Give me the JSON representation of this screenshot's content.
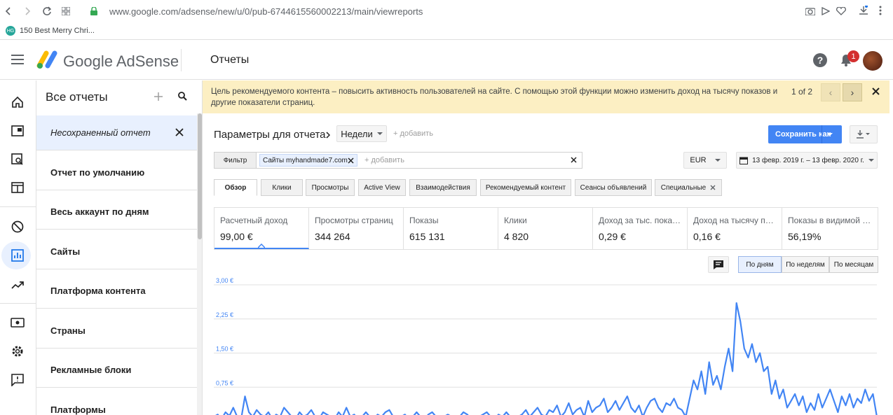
{
  "browser": {
    "url": "www.google.com/adsense/new/u/0/pub-6744615560002213/main/viewreports",
    "bookmark": "150 Best Merry Chri..."
  },
  "header": {
    "brand": "Google AdSense",
    "title": "Отчеты",
    "notifications": "1"
  },
  "sidebar": {
    "title": "Все отчеты",
    "items": [
      {
        "label": "Несохраненный отчет"
      },
      {
        "label": "Отчет по умолчанию"
      },
      {
        "label": "Весь аккаунт по дням"
      },
      {
        "label": "Сайты"
      },
      {
        "label": "Платформа контента"
      },
      {
        "label": "Страны"
      },
      {
        "label": "Рекламные блоки"
      },
      {
        "label": "Платформы"
      }
    ]
  },
  "notice": {
    "text": "Цель рекомендуемого контента – повысить активность пользователей на сайте. С помощью этой функции можно изменить доход на тысячу показов и другие показатели страниц.",
    "pages": "1 of 2"
  },
  "params": {
    "label": "Параметры для отчета:",
    "dimension": "Недели",
    "add": "+ добавить",
    "save": "Сохранить как"
  },
  "filter": {
    "label": "Фильтр",
    "chip": "Сайты myhandmade7.com",
    "add": "+ добавить",
    "currency": "EUR",
    "date_range": "13 февр. 2019 г. – 13 февр. 2020 г."
  },
  "tabs": [
    "Обзор",
    "Клики",
    "Просмотры",
    "Active View",
    "Взаимодействия",
    "Рекомендуемый контент",
    "Сеансы объявлений",
    "Специальные"
  ],
  "metrics": [
    {
      "label": "Расчетный доход",
      "value": "99,00 €"
    },
    {
      "label": "Просмотры страниц",
      "value": "344 264"
    },
    {
      "label": "Показы",
      "value": "615 131"
    },
    {
      "label": "Клики",
      "value": "4 820"
    },
    {
      "label": "Доход за тыс. показов",
      "value": "0,29 €"
    },
    {
      "label": "Доход на тысячу показов",
      "value": "0,16 €"
    },
    {
      "label": "Показы в видимой части",
      "value": "56,19%"
    }
  ],
  "granularity": [
    "По дням",
    "По неделям",
    "По месяцам"
  ],
  "chart_data": {
    "type": "line",
    "y_ticks": [
      "3,00 €",
      "2,25 €",
      "1,50 €",
      "0,75 €"
    ],
    "ylim": [
      0,
      3.0
    ],
    "series": [
      {
        "values": [
          0.1,
          0.15,
          0.05,
          0.2,
          0.12,
          0.3,
          0.1,
          0.05,
          0.55,
          0.2,
          0.1,
          0.25,
          0.15,
          0.1,
          0.2,
          0.05,
          0.15,
          0.1,
          0.3,
          0.2,
          0.1,
          0.05,
          0.2,
          0.1,
          0.15,
          0.25,
          0.1,
          0.05,
          0.2,
          0.15,
          0.1,
          0.05,
          0.2,
          0.1,
          0.3,
          0.1,
          0.15,
          0.05,
          0.1,
          0.2,
          0.1,
          0.05,
          0.15,
          0.1,
          0.2,
          0.25,
          0.1,
          0.05,
          0.1,
          0.15,
          0.05,
          0.1,
          0.2,
          0.1,
          0.05,
          0.15,
          0.2,
          0.1,
          0.05,
          0.1,
          0.15,
          0.1,
          0.05,
          0.1,
          0.2,
          0.15,
          0.05,
          0.1,
          0.1,
          0.15,
          0.2,
          0.1,
          0.05,
          0.15,
          0.1,
          0.2,
          0.1,
          0.05,
          0.1,
          0.15,
          0.25,
          0.1,
          0.2,
          0.3,
          0.15,
          0.1,
          0.25,
          0.2,
          0.35,
          0.1,
          0.2,
          0.4,
          0.15,
          0.25,
          0.3,
          0.1,
          0.45,
          0.2,
          0.3,
          0.35,
          0.5,
          0.2,
          0.3,
          0.45,
          0.25,
          0.4,
          0.55,
          0.3,
          0.2,
          0.35,
          0.1,
          0.3,
          0.45,
          0.5,
          0.3,
          0.2,
          0.4,
          0.35,
          0.5,
          0.3,
          0.25,
          0.1,
          0.5,
          0.9,
          0.7,
          1.1,
          0.6,
          1.3,
          0.8,
          1.0,
          0.7,
          1.2,
          1.6,
          1.1,
          2.6,
          2.2,
          1.6,
          1.4,
          1.7,
          1.3,
          1.5,
          1.1,
          1.2,
          0.6,
          0.9,
          0.5,
          0.7,
          0.3,
          0.45,
          0.6,
          0.35,
          0.55,
          0.2,
          0.4,
          0.25,
          0.6,
          0.3,
          0.5,
          0.7,
          0.45,
          0.2,
          0.55,
          0.35,
          0.6,
          0.3,
          0.5,
          0.4,
          0.7,
          0.45,
          0.6,
          0.1
        ]
      }
    ]
  }
}
